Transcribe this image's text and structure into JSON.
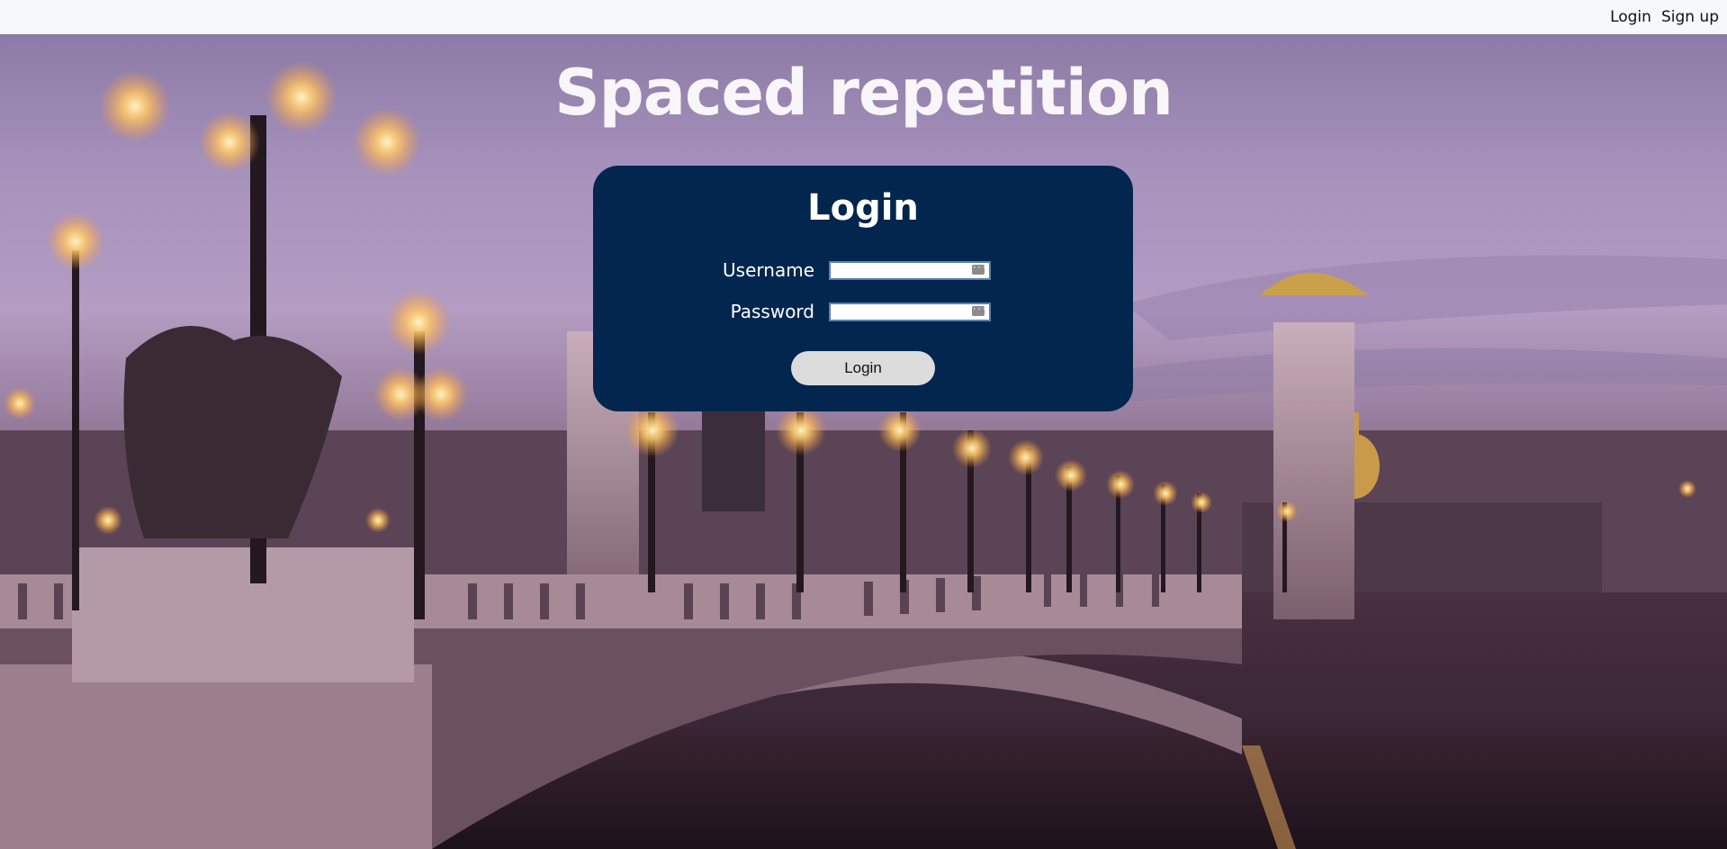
{
  "nav": {
    "login_label": "Login",
    "signup_label": "Sign up"
  },
  "hero": {
    "title": "Spaced repetition"
  },
  "login_form": {
    "title": "Login",
    "username_label": "Username",
    "username_value": "",
    "password_label": "Password",
    "password_value": "",
    "submit_label": "Login"
  },
  "colors": {
    "nav_background": "#f7f8fb",
    "card_background": "#03264f",
    "button_background": "#dcdcdc",
    "title_color": "#f8f6f8"
  },
  "icons": {
    "field_icon": "password-manager-key-icon"
  }
}
